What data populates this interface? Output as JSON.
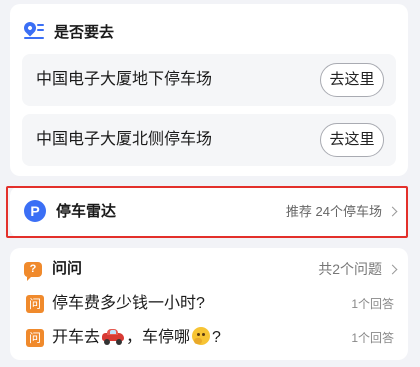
{
  "destination": {
    "title": "是否要去",
    "icon": "location-pin-icon",
    "accent_color": "#3b6ff5",
    "options": [
      {
        "label": "中国电子大厦地下停车场",
        "button": "去这里"
      },
      {
        "label": "中国电子大厦北侧停车场",
        "button": "去这里"
      }
    ]
  },
  "parking_radar": {
    "icon": "parking-p-icon",
    "icon_glyph": "P",
    "title": "停车雷达",
    "recommend": "推荐 24个停车场",
    "highlight_color": "#e3302b"
  },
  "qa": {
    "icon": "question-bubble-icon",
    "icon_glyph": "?",
    "title": "问问",
    "total": "共2个问题",
    "badge_glyph": "问",
    "badge_color": "#f08a2c",
    "questions": [
      {
        "text": "停车费多少钱一小时?",
        "answers": "1个回答"
      },
      {
        "text_before": "开车去",
        "text_middle": "，车停哪",
        "text_after": "?",
        "answers": "1个回答"
      }
    ]
  }
}
